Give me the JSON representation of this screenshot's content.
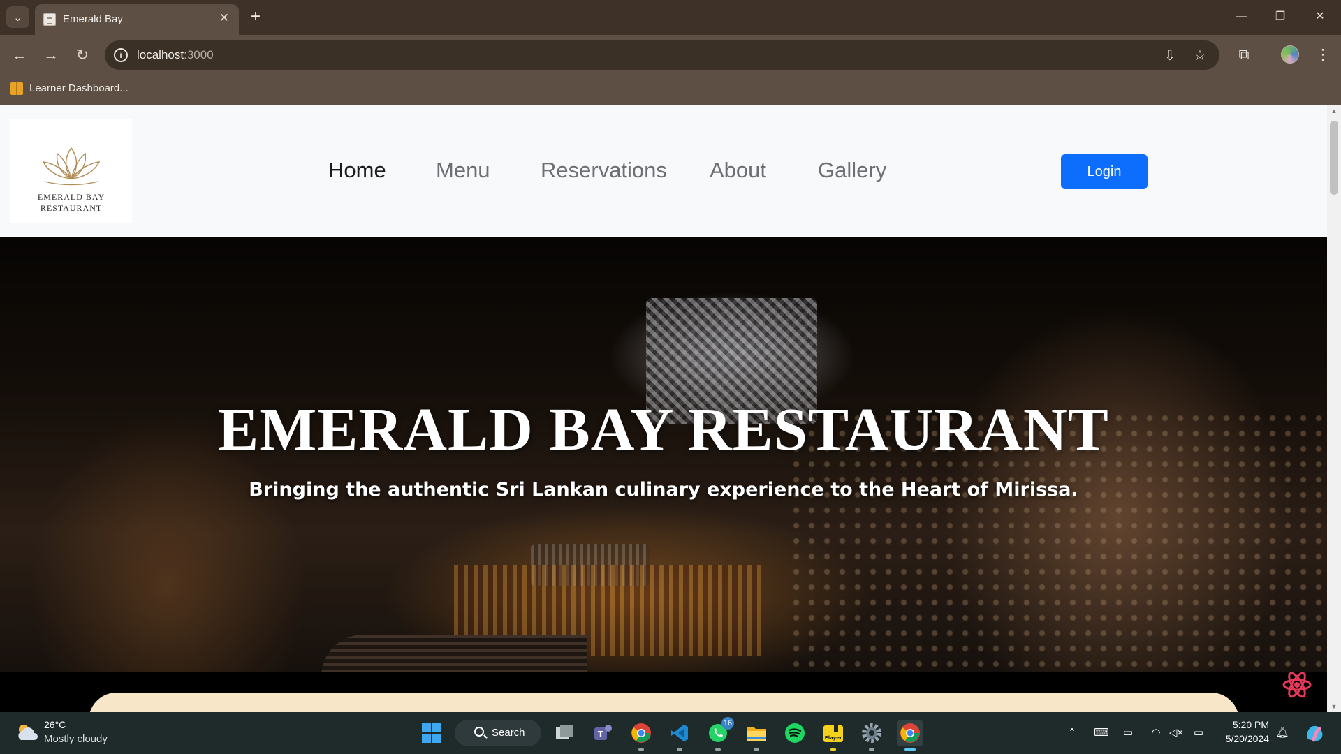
{
  "browser": {
    "tab_title": "Emerald Bay",
    "url_host": "localhost",
    "url_port": ":3000",
    "bookmark_label": "Learner Dashboard..."
  },
  "site": {
    "logo_line1": "EMERALD BAY",
    "logo_line2": "RESTAURANT",
    "nav": [
      {
        "label": "Home",
        "active": true
      },
      {
        "label": "Menu",
        "active": false
      },
      {
        "label": "Reservations",
        "active": false
      },
      {
        "label": "About",
        "active": false
      },
      {
        "label": "Gallery",
        "active": false
      }
    ],
    "login_label": "Login"
  },
  "hero": {
    "title": "EMERALD BAY RESTAURANT",
    "subtitle": "Bringing the authentic Sri Lankan culinary experience to the Heart of Mirissa."
  },
  "taskbar": {
    "weather_temp": "26°C",
    "weather_desc": "Mostly cloudy",
    "search_label": "Search",
    "whatsapp_badge": "16",
    "player_label": "Player",
    "time": "5:20 PM",
    "date": "5/20/2024"
  },
  "colors": {
    "primary_button": "#0d6efd",
    "header_bg": "#f8f9fa",
    "chrome_frame": "#5d4f43",
    "next_section_bg": "#f7e6c8"
  }
}
